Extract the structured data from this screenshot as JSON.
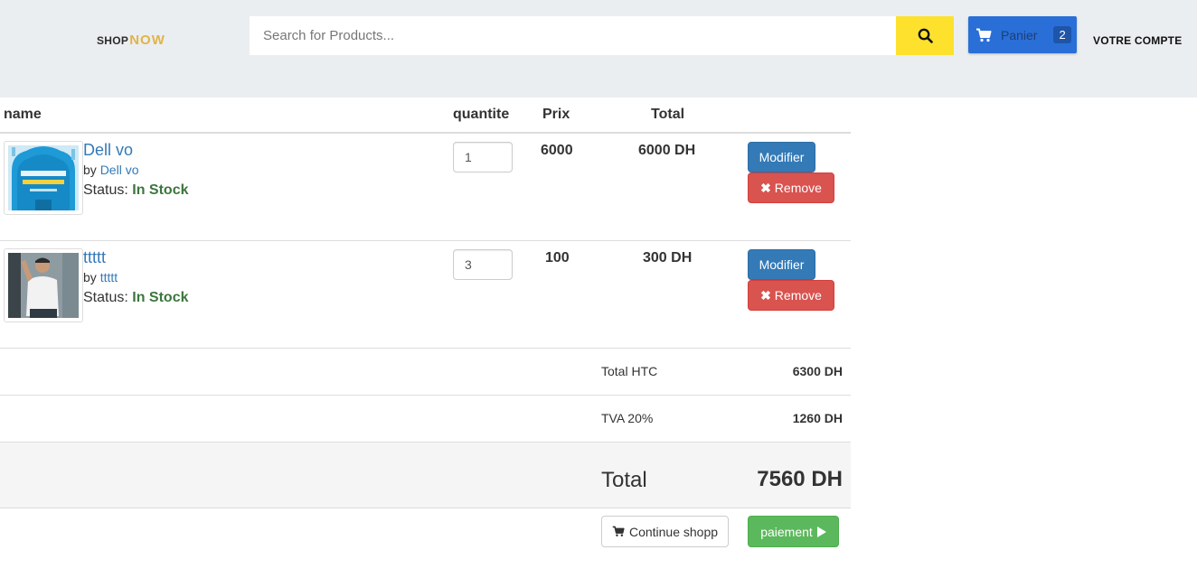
{
  "header": {
    "logo_part1": "SHOP",
    "logo_part2": "NOW",
    "search_placeholder": "Search for Products...",
    "search_icon": "search-icon",
    "cart_icon": "cart-icon",
    "cart_label": "Panier",
    "cart_count": "2",
    "account_label": "VOTRE COMPTE"
  },
  "table": {
    "headers": {
      "name": "name",
      "quantite": "quantite",
      "prix": "Prix",
      "total": "Total"
    },
    "items": [
      {
        "name": "Dell vo",
        "by_prefix": "by",
        "by": "Dell vo",
        "status_label": "Status:",
        "status": "In Stock",
        "quantity": "1",
        "price": "6000",
        "total": "6000 DH",
        "modify_label": "Modifier",
        "remove_label": "Remove",
        "thumb_icon": "book-cover-image"
      },
      {
        "name": "ttttt",
        "by_prefix": "by",
        "by": "ttttt",
        "status_label": "Status:",
        "status": "In Stock",
        "quantity": "3",
        "price": "100",
        "total": "300 DH",
        "modify_label": "Modifier",
        "remove_label": "Remove",
        "thumb_icon": "person-photo-image"
      }
    ]
  },
  "summary": {
    "total_htc_label": "Total HTC",
    "total_htc_value": "6300 DH",
    "tva_label": "TVA 20%",
    "tva_value": "1260 DH",
    "total_label": "Total",
    "total_value": "7560 DH"
  },
  "actions": {
    "continue_label": "Continue shopp",
    "pay_label": "paiement"
  },
  "colors": {
    "header_bg": "#ebeef0",
    "search_button": "#fde12d",
    "cart_button": "#2a6fd7",
    "primary": "#337ab7",
    "danger": "#d9534f",
    "success": "#5cb85c",
    "in_stock": "#3c763d"
  }
}
